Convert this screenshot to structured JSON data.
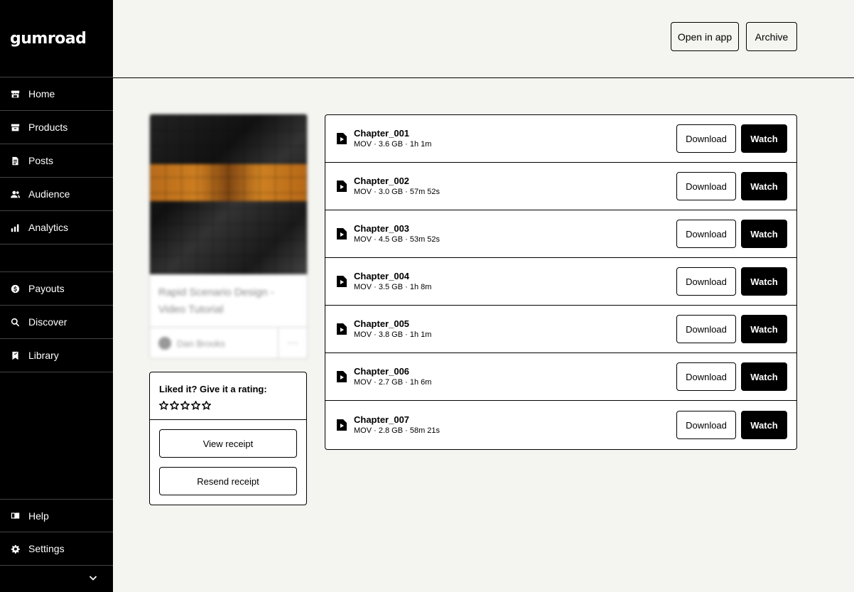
{
  "brand": {
    "logo_text": "Gumroad"
  },
  "sidebar": {
    "items": [
      {
        "label": "Home",
        "icon": "store-icon"
      },
      {
        "label": "Products",
        "icon": "archive-box-icon"
      },
      {
        "label": "Posts",
        "icon": "document-icon"
      },
      {
        "label": "Audience",
        "icon": "people-icon"
      },
      {
        "label": "Analytics",
        "icon": "bar-chart-icon"
      },
      {
        "label": "Payouts",
        "icon": "dollar-circle-icon"
      },
      {
        "label": "Discover",
        "icon": "search-icon"
      },
      {
        "label": "Library",
        "icon": "bookmark-icon"
      }
    ],
    "bottom_items": [
      {
        "label": "Help",
        "icon": "book-icon"
      },
      {
        "label": "Settings",
        "icon": "gear-icon"
      }
    ]
  },
  "header": {
    "open_in_app_label": "Open in app",
    "archive_label": "Archive"
  },
  "product_card": {
    "title": "Rapid Scenario Design - Video Tutorial",
    "creator": "Dan Brooks",
    "more_label": "···"
  },
  "rating": {
    "label": "Liked it? Give it a rating:",
    "star_count": 5,
    "view_receipt_label": "View receipt",
    "resend_receipt_label": "Resend receipt"
  },
  "files": [
    {
      "name": "Chapter_001",
      "meta": "MOV · 3.6 GB · 1h 1m"
    },
    {
      "name": "Chapter_002",
      "meta": "MOV · 3.0 GB · 57m 52s"
    },
    {
      "name": "Chapter_003",
      "meta": "MOV · 4.5 GB · 53m 52s"
    },
    {
      "name": "Chapter_004",
      "meta": "MOV · 3.5 GB · 1h 8m"
    },
    {
      "name": "Chapter_005",
      "meta": "MOV · 3.8 GB · 1h 1m"
    },
    {
      "name": "Chapter_006",
      "meta": "MOV · 2.7 GB · 1h 6m"
    },
    {
      "name": "Chapter_007",
      "meta": "MOV · 2.8 GB · 58m 21s"
    }
  ],
  "file_actions": {
    "download_label": "Download",
    "watch_label": "Watch"
  },
  "colors": {
    "sidebar_bg": "#000000",
    "page_bg": "#f4f4f0",
    "watch_bg": "#000000"
  }
}
